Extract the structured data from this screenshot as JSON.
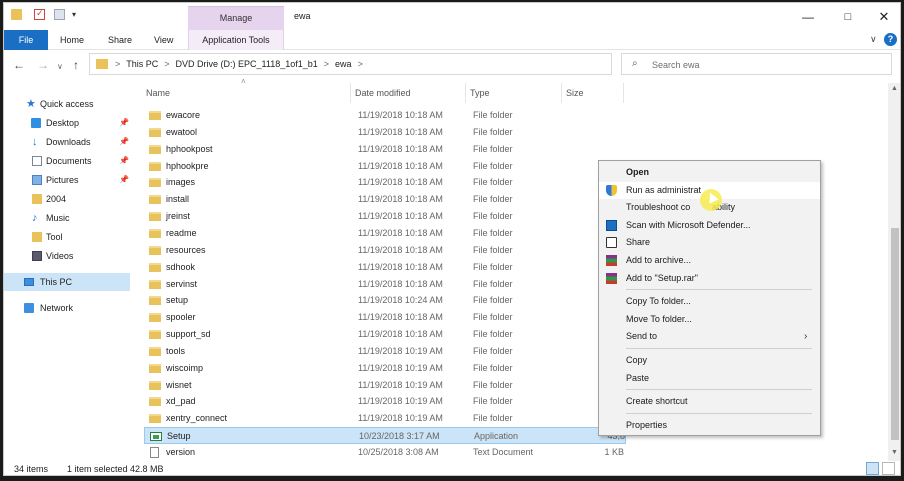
{
  "window": {
    "title": "ewa",
    "quick_access_arrow": "▾",
    "controls": {
      "minimize": "—",
      "maximize": "□",
      "close": "✕"
    }
  },
  "ribbon": {
    "tabs": [
      "File",
      "Home",
      "Share",
      "View"
    ],
    "context_group": "Manage",
    "context_tab": "Application Tools",
    "collapse_glyph": "∨",
    "help_glyph": "?"
  },
  "address": {
    "back": "←",
    "forward": "→",
    "recent": "∨",
    "up": "↑",
    "separator": ">",
    "breadcrumbs": [
      "This PC",
      "DVD Drive (D:) EPC_1118_1of1_b1",
      "ewa"
    ],
    "dropdown": "∨",
    "refresh": "↻"
  },
  "search": {
    "placeholder": "Search ewa",
    "icon": "⌕"
  },
  "navpane": {
    "pin_glyph": "📌",
    "items": [
      {
        "label": "Quick access",
        "icon": "star-icon",
        "glyph": "★"
      },
      {
        "label": "Desktop",
        "icon": "desktop-icon",
        "pinned": true
      },
      {
        "label": "Downloads",
        "icon": "download-icon",
        "glyph": "↓",
        "pinned": true
      },
      {
        "label": "Documents",
        "icon": "document-icon",
        "pinned": true
      },
      {
        "label": "Pictures",
        "icon": "pictures-icon",
        "pinned": true
      },
      {
        "label": "2004",
        "icon": "folder-icon"
      },
      {
        "label": "Music",
        "icon": "music-icon",
        "glyph": "♪"
      },
      {
        "label": "Tool",
        "icon": "folder-icon"
      },
      {
        "label": "Videos",
        "icon": "videos-icon"
      },
      {
        "label": "This PC",
        "icon": "pc-icon",
        "selected": true
      },
      {
        "label": "Network",
        "icon": "network-icon"
      }
    ]
  },
  "columns": {
    "name": "Name",
    "date": "Date modified",
    "type": "Type",
    "size": "Size",
    "sort_glyph": "˄"
  },
  "files": [
    {
      "name": "ewacore",
      "date": "11/19/2018 10:18 AM",
      "type": "File folder",
      "size": "",
      "kind": "folder"
    },
    {
      "name": "ewatool",
      "date": "11/19/2018 10:18 AM",
      "type": "File folder",
      "size": "",
      "kind": "folder"
    },
    {
      "name": "hphookpost",
      "date": "11/19/2018 10:18 AM",
      "type": "File folder",
      "size": "",
      "kind": "folder"
    },
    {
      "name": "hphookpre",
      "date": "11/19/2018 10:18 AM",
      "type": "File folder",
      "size": "",
      "kind": "folder"
    },
    {
      "name": "images",
      "date": "11/19/2018 10:18 AM",
      "type": "File folder",
      "size": "",
      "kind": "folder"
    },
    {
      "name": "install",
      "date": "11/19/2018 10:18 AM",
      "type": "File folder",
      "size": "",
      "kind": "folder"
    },
    {
      "name": "jreinst",
      "date": "11/19/2018 10:18 AM",
      "type": "File folder",
      "size": "",
      "kind": "folder"
    },
    {
      "name": "readme",
      "date": "11/19/2018 10:18 AM",
      "type": "File folder",
      "size": "",
      "kind": "folder"
    },
    {
      "name": "resources",
      "date": "11/19/2018 10:18 AM",
      "type": "File folder",
      "size": "",
      "kind": "folder"
    },
    {
      "name": "sdhook",
      "date": "11/19/2018 10:18 AM",
      "type": "File folder",
      "size": "",
      "kind": "folder"
    },
    {
      "name": "servinst",
      "date": "11/19/2018 10:18 AM",
      "type": "File folder",
      "size": "",
      "kind": "folder"
    },
    {
      "name": "setup",
      "date": "11/19/2018 10:24 AM",
      "type": "File folder",
      "size": "",
      "kind": "folder"
    },
    {
      "name": "spooler",
      "date": "11/19/2018 10:18 AM",
      "type": "File folder",
      "size": "",
      "kind": "folder"
    },
    {
      "name": "support_sd",
      "date": "11/19/2018 10:18 AM",
      "type": "File folder",
      "size": "",
      "kind": "folder"
    },
    {
      "name": "tools",
      "date": "11/19/2018 10:19 AM",
      "type": "File folder",
      "size": "",
      "kind": "folder"
    },
    {
      "name": "wiscoimp",
      "date": "11/19/2018 10:19 AM",
      "type": "File folder",
      "size": "",
      "kind": "folder"
    },
    {
      "name": "wisnet",
      "date": "11/19/2018 10:19 AM",
      "type": "File folder",
      "size": "",
      "kind": "folder"
    },
    {
      "name": "xd_pad",
      "date": "11/19/2018 10:19 AM",
      "type": "File folder",
      "size": "",
      "kind": "folder"
    },
    {
      "name": "xentry_connect",
      "date": "11/19/2018 10:19 AM",
      "type": "File folder",
      "size": "",
      "kind": "folder"
    },
    {
      "name": "Setup",
      "date": "10/23/2018 3:17 AM",
      "type": "Application",
      "size": "43,8",
      "kind": "app",
      "selected": true
    },
    {
      "name": "version",
      "date": "10/25/2018 3:08 AM",
      "type": "Text Document",
      "size": "1 KB",
      "kind": "text"
    }
  ],
  "status": {
    "items": "34 items",
    "selected": "1 item selected  42.8 MB"
  },
  "scrollbar": {
    "up": "▲",
    "down": "▼"
  },
  "context_menu": {
    "submenu_glyph": "›",
    "items": [
      {
        "label": "Open",
        "bold": true,
        "icon": ""
      },
      {
        "label": "Run as administrat",
        "icon": "shield-icon",
        "hover": true
      },
      {
        "label": "Troubleshoot co",
        "icon": ""
      },
      {
        "label": "Scan with Microsoft Defender...",
        "icon": "defender-icon"
      },
      {
        "label": "Share",
        "icon": "share-icon"
      },
      {
        "label": "Add to archive...",
        "icon": "winrar-icon"
      },
      {
        "label": "Add to \"Setup.rar\"",
        "icon": "winrar-icon"
      },
      {
        "sep": true
      },
      {
        "label": "Copy To folder...",
        "icon": ""
      },
      {
        "label": "Move To folder...",
        "icon": ""
      },
      {
        "label": "Send to",
        "icon": "",
        "submenu": true
      },
      {
        "sep": true
      },
      {
        "label": "Copy",
        "icon": ""
      },
      {
        "label": "Paste",
        "icon": ""
      },
      {
        "sep": true
      },
      {
        "label": "Create shortcut",
        "icon": ""
      },
      {
        "sep": true
      },
      {
        "label": "Properties",
        "icon": ""
      }
    ],
    "partial_text": "ability"
  }
}
